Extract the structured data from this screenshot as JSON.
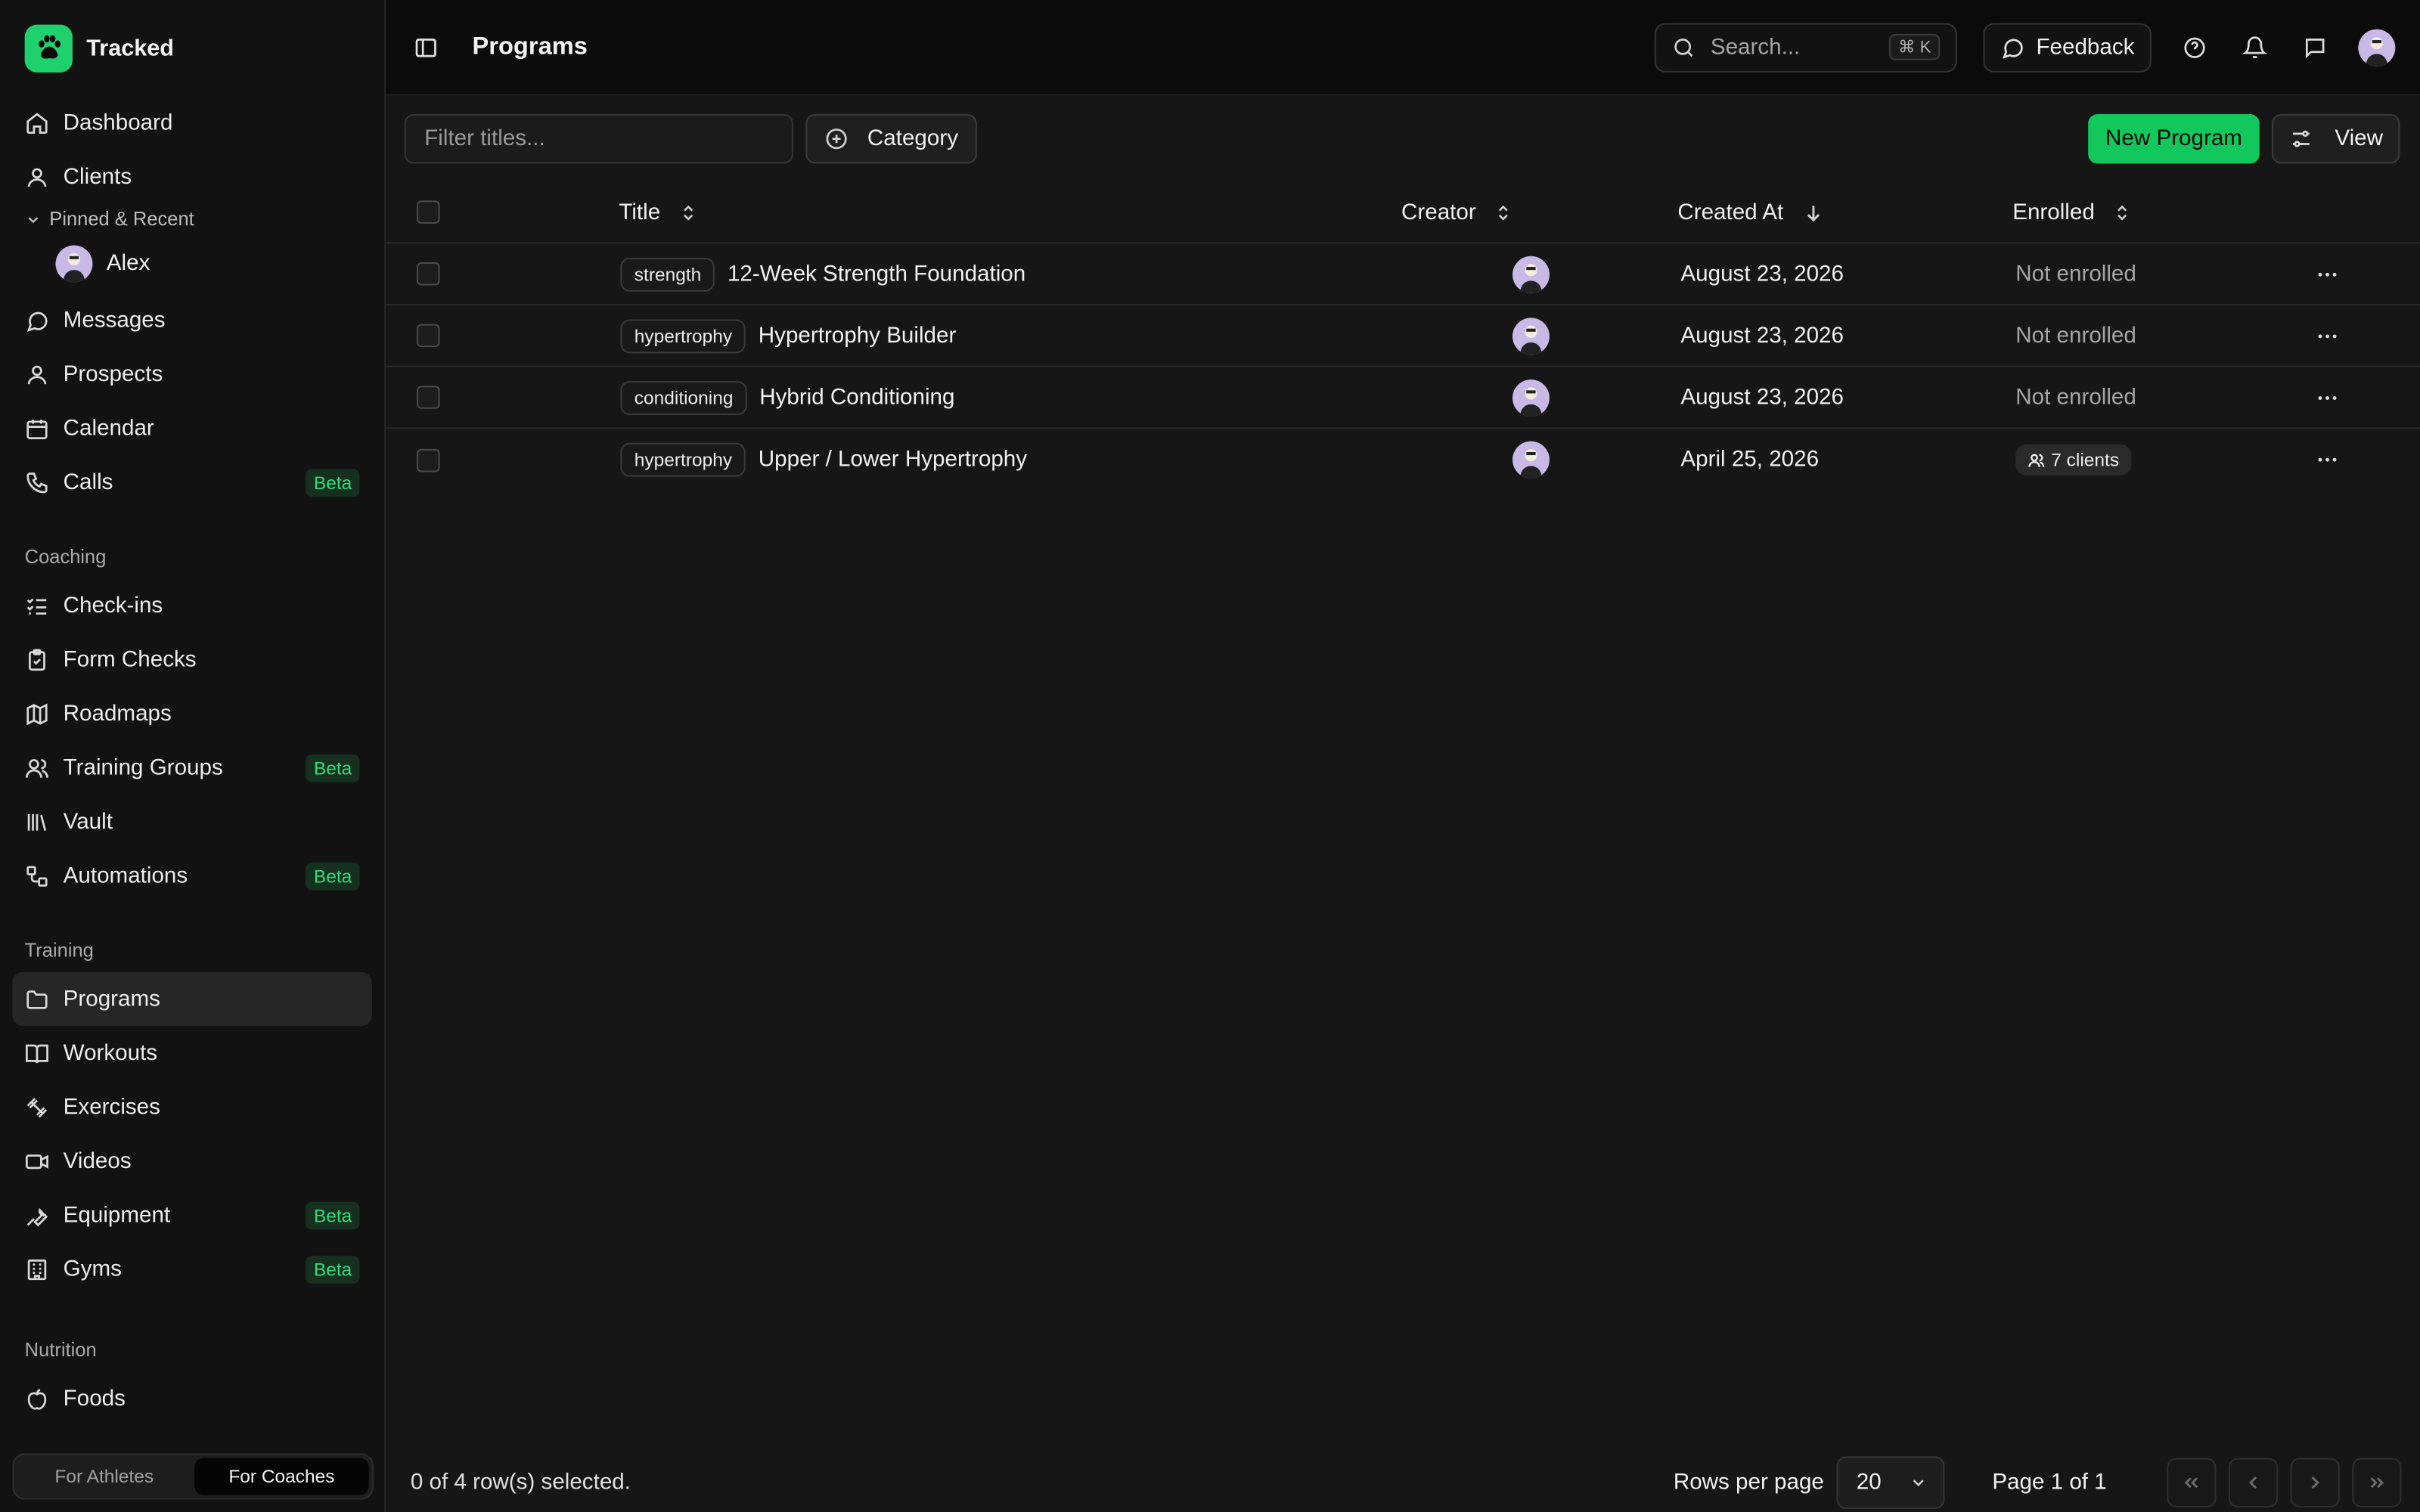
{
  "app": {
    "name": "Tracked",
    "accent": "#1fd16c"
  },
  "sidebar": {
    "top_items": [
      {
        "label": "Dashboard",
        "icon": "home-icon"
      },
      {
        "label": "Clients",
        "icon": "user-icon"
      }
    ],
    "pinned": {
      "header": "Pinned & Recent",
      "user": "Alex"
    },
    "main_items": [
      {
        "label": "Messages",
        "icon": "message-icon"
      },
      {
        "label": "Prospects",
        "icon": "users-icon"
      },
      {
        "label": "Calendar",
        "icon": "calendar-icon"
      },
      {
        "label": "Calls",
        "icon": "phone-icon",
        "badge": "Beta"
      }
    ],
    "coaching": {
      "header": "Coaching",
      "items": [
        {
          "label": "Check-ins",
          "icon": "checklist-icon"
        },
        {
          "label": "Form Checks",
          "icon": "clipboard-check-icon"
        },
        {
          "label": "Roadmaps",
          "icon": "map-icon"
        },
        {
          "label": "Training Groups",
          "icon": "users-icon",
          "badge": "Beta"
        },
        {
          "label": "Vault",
          "icon": "library-icon"
        },
        {
          "label": "Automations",
          "icon": "workflow-icon",
          "badge": "Beta"
        }
      ]
    },
    "training": {
      "header": "Training",
      "items": [
        {
          "label": "Programs",
          "icon": "folder-icon"
        },
        {
          "label": "Workouts",
          "icon": "book-icon"
        },
        {
          "label": "Exercises",
          "icon": "dumbbell-icon"
        },
        {
          "label": "Videos",
          "icon": "video-icon"
        },
        {
          "label": "Equipment",
          "icon": "wrench-icon",
          "badge": "Beta"
        },
        {
          "label": "Gyms",
          "icon": "building-icon",
          "badge": "Beta"
        }
      ]
    },
    "nutrition": {
      "header": "Nutrition",
      "items": [
        {
          "label": "Foods",
          "icon": "apple-icon"
        }
      ]
    },
    "mode_toggle": {
      "athletes": "For Athletes",
      "coaches": "For Coaches",
      "selected": "For Coaches"
    }
  },
  "header": {
    "title": "Programs",
    "search_placeholder": "Search...",
    "search_shortcut": "⌘ K",
    "feedback_label": "Feedback"
  },
  "toolbar": {
    "filter_placeholder": "Filter titles...",
    "category_label": "Category",
    "new_program_label": "New Program",
    "view_label": "View"
  },
  "table": {
    "columns": {
      "title": "Title",
      "creator": "Creator",
      "created_at": "Created At",
      "enrolled": "Enrolled"
    },
    "rows": [
      {
        "tag": "strength",
        "title": "12-Week Strength Foundation",
        "created_at": "August 23, 2026",
        "enrolled": "Not enrolled"
      },
      {
        "tag": "hypertrophy",
        "title": "Hypertrophy Builder",
        "created_at": "August 23, 2026",
        "enrolled": "Not enrolled"
      },
      {
        "tag": "conditioning",
        "title": "Hybrid Conditioning",
        "created_at": "August 23, 2026",
        "enrolled": "Not enrolled"
      },
      {
        "tag": "hypertrophy",
        "title": "Upper / Lower Hypertrophy",
        "created_at": "April 25, 2026",
        "enrolled": "7 clients"
      }
    ]
  },
  "footer": {
    "selection": "0 of 4 row(s) selected.",
    "rows_per_page_label": "Rows per page",
    "rows_per_page_value": "20",
    "page_info": "Page 1 of 1"
  }
}
